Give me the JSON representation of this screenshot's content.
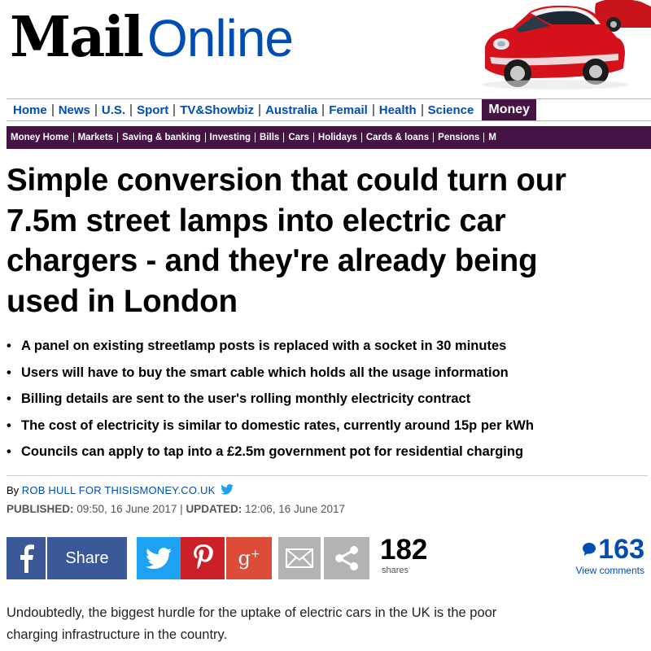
{
  "masthead": {
    "logo_main": "Mail",
    "logo_sub": "Online",
    "car_image": "red-car-icon"
  },
  "nav": {
    "items": [
      "Home",
      "News",
      "U.S.",
      "Sport",
      "TV&Showbiz",
      "Australia",
      "Femail",
      "Health",
      "Science"
    ],
    "active": "Money"
  },
  "subnav": {
    "items": [
      "Money Home",
      "Markets",
      "Saving & banking",
      "Investing",
      "Bills",
      "Cars",
      "Holidays",
      "Cards & loans",
      "Pensions",
      "M"
    ]
  },
  "article": {
    "headline_lines": [
      "Simple conversion that could turn our",
      "7.5m street lamps into electric car",
      "chargers - and they're already being",
      "used in London"
    ],
    "bullets": [
      "A panel on existing streetlamp posts is replaced with a socket in 30 minutes",
      "Users will have to buy the smart cable which holds all the usage information",
      "Billing details are sent to the user's rolling monthly electricity contract",
      "The cost of electricity is similar to domestic rates, currently around 15p per kWh",
      "Councils can apply to tap into a £2.5m government pot for residential charging"
    ],
    "byline_prefix": "By",
    "author": "ROB HULL FOR THISISMONEY.CO.UK",
    "published_label": "PUBLISHED:",
    "published_value": "09:50, 16 June 2017",
    "separator": "|",
    "updated_label": "UPDATED:",
    "updated_value": "12:06, 16 June 2017",
    "body_lines": [
      "Undoubtedly, the biggest hurdle for the uptake of electric cars in the UK is the poor",
      "charging infrastructure in the country."
    ]
  },
  "share": {
    "fb_label": "Share",
    "count": "182",
    "count_label": "shares",
    "icons": [
      "facebook-icon",
      "twitter-icon",
      "pinterest-icon",
      "google-plus-icon",
      "email-icon",
      "share-icon"
    ]
  },
  "comments": {
    "count": "163",
    "label": "View comments"
  },
  "colors": {
    "brand_blue": "#004db3",
    "money_purple": "#451344",
    "facebook": "#3b5998",
    "twitter": "#1da1f2",
    "pinterest": "#cb2027",
    "google_plus": "#dd4b39",
    "grey_button": "#b3b3b3"
  }
}
